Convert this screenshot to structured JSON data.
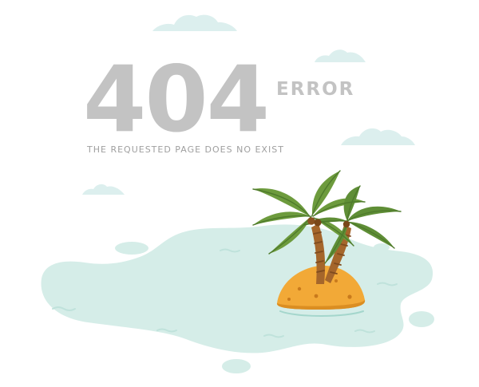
{
  "error_page": {
    "code": "404",
    "error_word": "ERROR",
    "message": "THE REQUESTED PAGE DOES NO EXIST"
  },
  "colors": {
    "text": "#c3c3c3",
    "subtext": "#9f9f9f",
    "cloud": "#dcefee",
    "water": "#d5ede8",
    "sand": "#f2a937",
    "trunk": "#a5662b",
    "leaf": "#6d9b3d"
  },
  "icons": [
    "cloud-icon",
    "palm-tree-icon",
    "island-icon"
  ]
}
